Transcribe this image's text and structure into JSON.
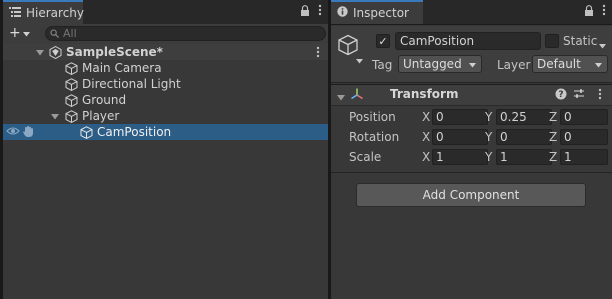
{
  "hierarchy": {
    "tab_label": "Hierarchy",
    "search_placeholder": "All",
    "plus_label": "+",
    "scene": {
      "name": "SampleScene*"
    },
    "items": [
      {
        "label": "Main Camera"
      },
      {
        "label": "Directional Light"
      },
      {
        "label": "Ground"
      },
      {
        "label": "Player"
      },
      {
        "label": "CamPosition"
      }
    ]
  },
  "inspector": {
    "tab_label": "Inspector",
    "object_name": "CamPosition",
    "active_check": "✓",
    "static_label": "Static",
    "tag_label": "Tag",
    "tag_value": "Untagged",
    "layer_label": "Layer",
    "layer_value": "Default",
    "component_title": "Transform",
    "position": {
      "label": "Position",
      "x": "0",
      "y": "0.25",
      "z": "0"
    },
    "rotation": {
      "label": "Rotation",
      "x": "0",
      "y": "0",
      "z": "0"
    },
    "scale": {
      "label": "Scale",
      "x": "1",
      "y": "1",
      "z": "1"
    },
    "axis_x": "X",
    "axis_y": "Y",
    "axis_z": "Z",
    "add_component_label": "Add Component"
  },
  "colors": {
    "selection": "#2c5d87",
    "tab_accent": "#3a79bb",
    "panel": "#383838"
  },
  "icons": [
    "hierarchy-list-icon",
    "lock-icon",
    "menu-dots-icon",
    "search-icon",
    "unity-scene-icon",
    "gameobject-cube-icon",
    "eye-icon",
    "pick-hand-icon",
    "info-icon",
    "transform-axes-icon",
    "help-icon",
    "preset-sliders-icon"
  ]
}
